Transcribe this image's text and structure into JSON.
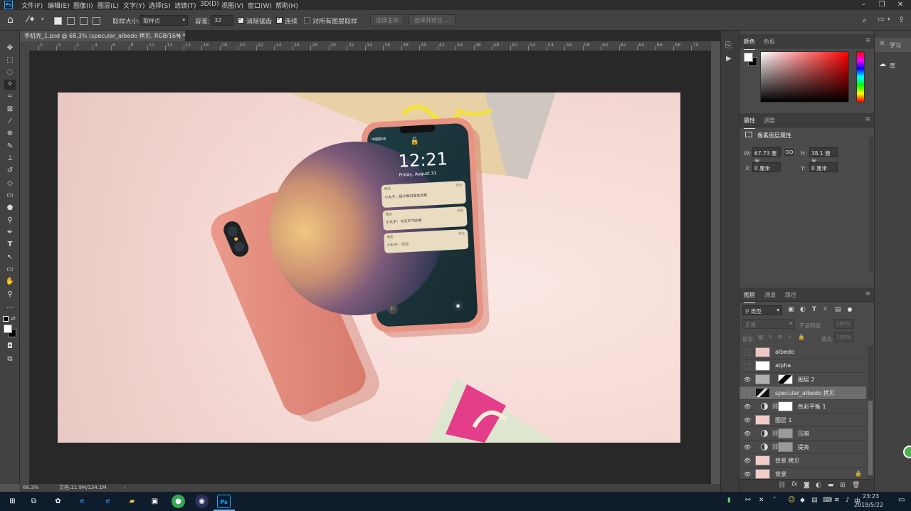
{
  "menu": {
    "items": [
      "文件(F)",
      "编辑(E)",
      "图像(I)",
      "图层(L)",
      "文字(Y)",
      "选择(S)",
      "滤镜(T)",
      "3D(D)",
      "视图(V)",
      "窗口(W)",
      "帮助(H)"
    ],
    "logo": "Ps"
  },
  "options": {
    "sample_size_label": "取样大小:",
    "sample_size_value": "取样点",
    "tolerance_label": "容差:",
    "tolerance_value": "32",
    "antialias_label": "消除锯齿",
    "contiguous_label": "连续",
    "sample_all_label": "对所有图层取样",
    "select_subject": "选择主体",
    "select_mask": "选择并遮住 ..."
  },
  "document": {
    "tab_title": "手机壳_1.psd @ 68.3% (specular_albedo 拷贝, RGB/16*) *",
    "close": "×"
  },
  "ruler": {
    "h_ticks": [
      "2",
      "0",
      "2",
      "4",
      "6",
      "8",
      "10",
      "12",
      "14",
      "16",
      "18",
      "20",
      "22",
      "24",
      "26",
      "28",
      "30",
      "32",
      "34",
      "36",
      "38",
      "40",
      "42",
      "44",
      "46",
      "48",
      "50",
      "52",
      "54",
      "56",
      "58",
      "60",
      "62",
      "64",
      "66",
      "68",
      "70"
    ]
  },
  "status": {
    "zoom": "68.3%",
    "doc_info": "文档:11.9M/134.1M",
    "arrow": "›"
  },
  "phone_screen": {
    "carrier": "中国移动",
    "time": "12:21",
    "date": "Friday, August 31",
    "notifications": [
      {
        "app": "微信",
        "when": "现在",
        "text": "小丸子：我今晚可能会迟到"
      },
      {
        "app": "微信",
        "when": "现在",
        "text": "小丸子：今天天气好晴"
      },
      {
        "app": "微信",
        "when": "现在",
        "text": "小丸子：😊😊"
      }
    ]
  },
  "color_panel": {
    "tabs": [
      "颜色",
      "色板"
    ],
    "menu": "≡"
  },
  "properties_panel": {
    "tabs": [
      "属性",
      "调整"
    ],
    "title": "像素图层属性",
    "w_label": "W:",
    "w_value": "67.73 厘米",
    "h_label": "H:",
    "h_value": "38.1 厘米",
    "x_label": "X:",
    "x_value": "0 厘米",
    "y_label": "Y:",
    "y_value": "0 厘米",
    "link": "GO"
  },
  "layers_panel": {
    "tabs": [
      "图层",
      "通道",
      "路径"
    ],
    "filter_kind": "类型",
    "blend_mode": "正常",
    "opacity_label": "不透明度:",
    "opacity_value": "100%",
    "lock_label": "锁定:",
    "fill_label": "填充:",
    "fill_value": "100%",
    "layers": [
      {
        "name": "albedo",
        "visible": false,
        "selected": false
      },
      {
        "name": "alpha",
        "visible": false,
        "selected": false
      },
      {
        "name": "图层 2",
        "visible": true,
        "selected": false
      },
      {
        "name": "specular_albedo 拷贝",
        "visible": false,
        "selected": true
      },
      {
        "name": "色彩平衡 1",
        "visible": true,
        "selected": false
      },
      {
        "name": "图层 1",
        "visible": true,
        "selected": false
      },
      {
        "name": "压暗",
        "visible": true,
        "selected": false
      },
      {
        "name": "提亮",
        "visible": true,
        "selected": false
      },
      {
        "name": "背景 拷贝",
        "visible": true,
        "selected": false
      },
      {
        "name": "背景",
        "visible": true,
        "selected": false
      }
    ]
  },
  "right_dock": {
    "learn": "学习",
    "libraries": "库"
  },
  "taskbar": {
    "time": "23:23",
    "date": "2019/5/22",
    "ime": "中"
  },
  "colors": {
    "menubar": "#2d2d2d",
    "panel": "#4a4a4a",
    "canvas_bg": "#282828",
    "phone_case": "#e08a7c",
    "accent_green": "#4caf50"
  }
}
